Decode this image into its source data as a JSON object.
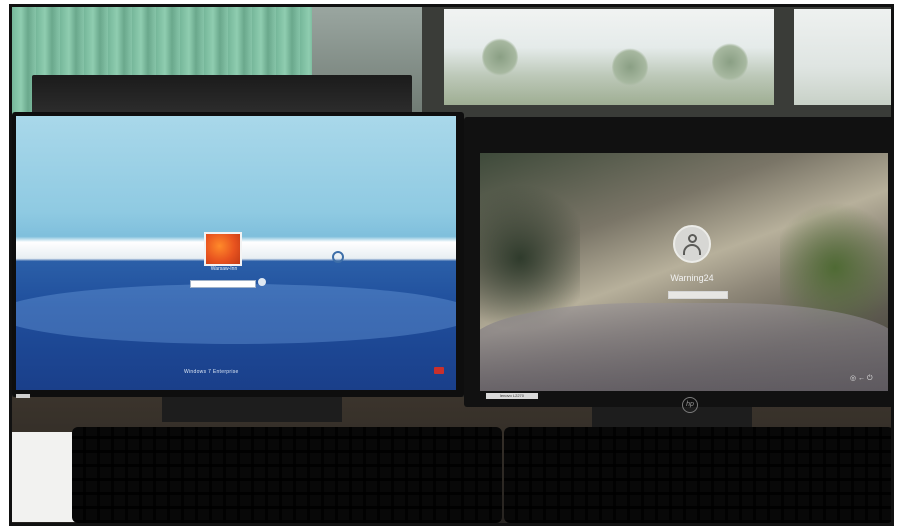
{
  "photo": {
    "left_monitor": {
      "user_caption": "Warsaw-Inn",
      "footer_brand": "Windows 7 Enterprise"
    },
    "right_monitor": {
      "user_name": "Warning24",
      "tray_icons": "◎ ← ⏻",
      "bezel_label": "lenovo L2270"
    },
    "hp_logo": "hp"
  },
  "colors": {
    "curtain": "#86c4a8",
    "win7_sky": "#8fcae2",
    "win7_sea": "#1f4e9c",
    "avatar_orange": "#e8531f",
    "win10_blur": "#8f8879"
  },
  "icons": [
    "user-avatar-icon",
    "ease-of-access-icon",
    "power-icon",
    "network-icon",
    "hp-logo-icon"
  ]
}
